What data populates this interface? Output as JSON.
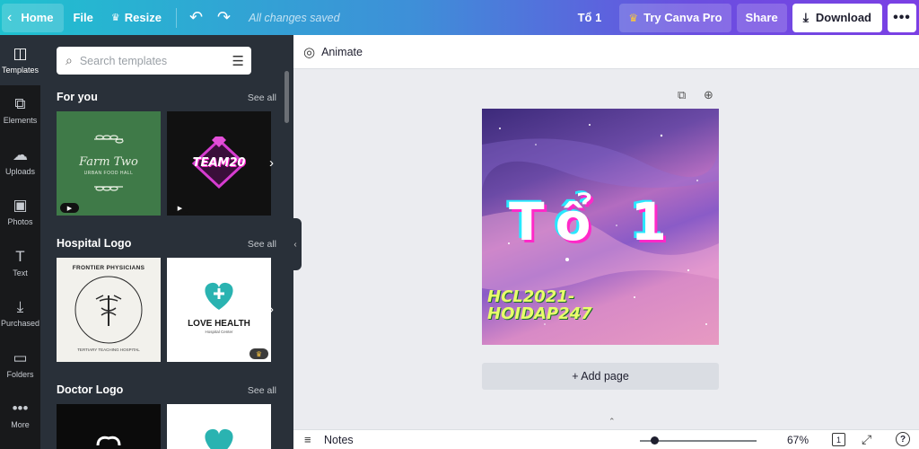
{
  "topbar": {
    "home_label": "Home",
    "file_label": "File",
    "resize_label": "Resize",
    "saved_status": "All changes saved",
    "design_title": "Tổ 1",
    "pro_label": "Try Canva Pro",
    "share_label": "Share",
    "download_label": "Download",
    "more_label": "•••"
  },
  "rail": {
    "items": [
      {
        "label": "Templates",
        "icon": "templates-icon"
      },
      {
        "label": "Elements",
        "icon": "elements-icon"
      },
      {
        "label": "Uploads",
        "icon": "uploads-icon"
      },
      {
        "label": "Photos",
        "icon": "photos-icon"
      },
      {
        "label": "Text",
        "icon": "text-icon"
      },
      {
        "label": "Purchased",
        "icon": "purchased-icon"
      },
      {
        "label": "Folders",
        "icon": "folders-icon"
      },
      {
        "label": "More",
        "icon": "more-icon"
      }
    ]
  },
  "panel": {
    "search_placeholder": "Search templates",
    "see_all": "See all",
    "sections": [
      {
        "title": "For you"
      },
      {
        "title": "Hospital Logo"
      },
      {
        "title": "Doctor Logo"
      }
    ],
    "thumbs": {
      "farm_text": "Farm Two",
      "farm_sub": "URBAN FOOD HALL",
      "team_text": "TEAM20",
      "frontier_text": "FRONTIER PHYSICIANS",
      "frontier_sub": "TERTIARY TEACHING HOSPITAL",
      "love_text": "LOVE HEALTH",
      "love_sub": "Hospital Center"
    }
  },
  "editor": {
    "animate_label": "Animate",
    "design_text": "Tổ 1",
    "design_caption_1": "HCL2021-",
    "design_caption_2": "HOIDAP247",
    "add_page_label": "+ Add page"
  },
  "bottombar": {
    "notes_label": "Notes",
    "zoom": "67%",
    "zoom_fraction": 0.09,
    "page_count": "1",
    "help_label": "?"
  },
  "colors": {
    "accent_gradient_start": "#1fc1cf",
    "accent_gradient_end": "#7b3fe4",
    "rail_bg": "#18191b",
    "panel_bg": "#293039",
    "editor_bg": "#ebecf0"
  }
}
